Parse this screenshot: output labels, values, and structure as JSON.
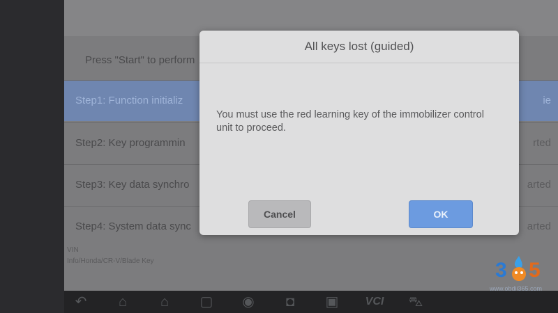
{
  "background_app": {
    "intro_text": "Press \"Start\" to perform",
    "steps": [
      {
        "label": "Step1: Function initializ",
        "status": "ie"
      },
      {
        "label": "Step2: Key programmin",
        "status": "rted"
      },
      {
        "label": "Step3: Key data synchro",
        "status": "arted"
      },
      {
        "label": "Step4: System data sync",
        "status": "arted"
      }
    ],
    "vin_label": "VIN",
    "vehicle_info": "Info/Honda/CR-V/Blade Key"
  },
  "dialog": {
    "title": "All keys lost (guided)",
    "message": "You must use the red learning key of the immobilizer control unit to proceed.",
    "cancel_label": "Cancel",
    "ok_label": "OK"
  },
  "taskbar": {
    "icons": [
      "back-icon",
      "home-icon",
      "home-alt-icon",
      "square-icon",
      "chrome-icon",
      "camera-icon",
      "gallery-icon",
      "vci-icon",
      "car-icon"
    ],
    "vci_text": "VCI"
  },
  "watermark": {
    "digit_left": "3",
    "digit_right": "5",
    "site": "www.obdii365.com",
    "colors": {
      "left": "#2a7ad4",
      "right": "#e26a1c"
    }
  }
}
